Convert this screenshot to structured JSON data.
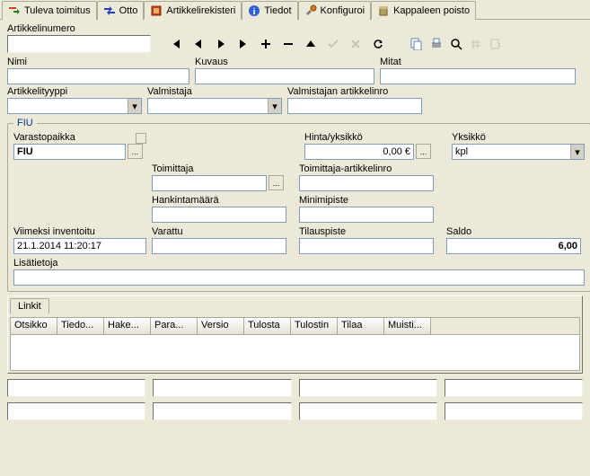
{
  "tabs": [
    {
      "label": "Tuleva toimitus"
    },
    {
      "label": "Otto"
    },
    {
      "label": "Artikkelirekisteri"
    },
    {
      "label": "Tiedot"
    },
    {
      "label": "Konfiguroi"
    },
    {
      "label": "Kappaleen poisto"
    }
  ],
  "labels": {
    "artikkelinumero": "Artikkelinumero",
    "nimi": "Nimi",
    "kuvaus": "Kuvaus",
    "mitat": "Mitat",
    "artikkelityyppi": "Artikkelityyppi",
    "valmistaja": "Valmistaja",
    "valmistajan_artikkelinro": "Valmistajan artikkelinro",
    "fiu_legend": "FIU",
    "varastopaikka": "Varastopaikka",
    "hinta_yksikko": "Hinta/yksikkö",
    "yksikko": "Yksikkö",
    "toimittaja": "Toimittaja",
    "toimittaja_artikkelinro": "Toimittaja-artikkelinro",
    "hankintamaara": "Hankintamäärä",
    "minimipiste": "Minimipiste",
    "viimeksi_inventoitu": "Viimeksi inventoitu",
    "varattu": "Varattu",
    "tilauspiste": "Tilauspiste",
    "saldo": "Saldo",
    "lisatietoja": "Lisätietoja",
    "linkit": "Linkit",
    "ellipsis": "..."
  },
  "values": {
    "artikkelinumero": "",
    "nimi": "",
    "kuvaus": "",
    "mitat": "",
    "artikkelityyppi": "",
    "valmistaja": "",
    "valmistajan_artikkelinro": "",
    "varastopaikka": "FIU",
    "hinta": "0,00 €",
    "yksikko": "kpl",
    "toimittaja": "",
    "toimittaja_artikkelinro": "",
    "hankintamaara": "",
    "minimipiste": "",
    "viimeksi_inventoitu": "21.1.2014 11:20:17",
    "varattu": "",
    "tilauspiste": "",
    "saldo": "6,00",
    "lisatietoja": ""
  },
  "grid_headers": [
    "Otsikko",
    "Tiedo...",
    "Hake...",
    "Para...",
    "Versio",
    "Tulosta",
    "Tulostin",
    "Tilaa",
    "Muisti..."
  ]
}
